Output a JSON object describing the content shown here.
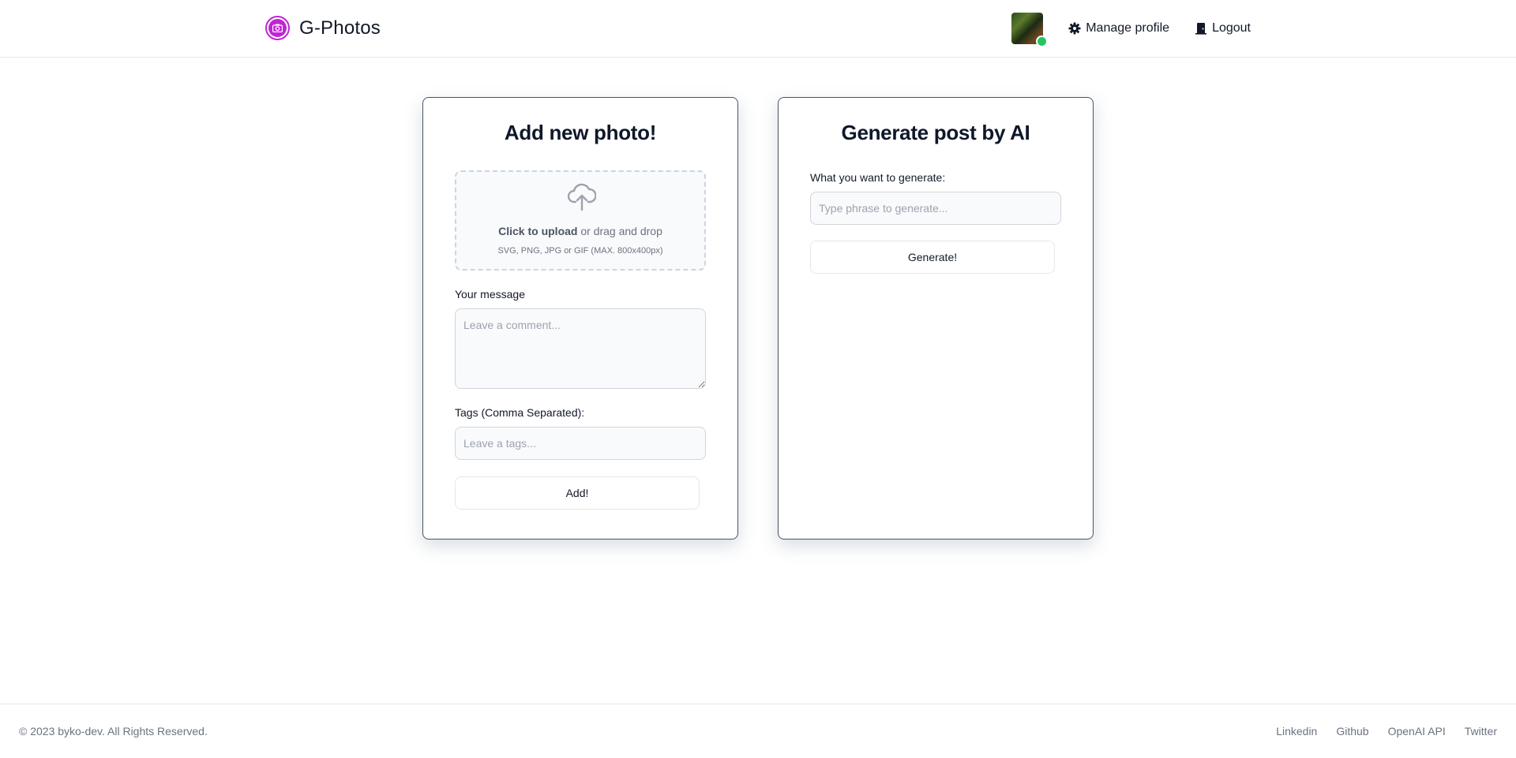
{
  "header": {
    "brand_name": "G-Photos",
    "brand_color": "#c026d3",
    "nav": {
      "manage_profile": "Manage profile",
      "logout": "Logout"
    },
    "avatar_status_color": "#22c55e"
  },
  "add_photo": {
    "title": "Add new photo!",
    "upload": {
      "click_text": "Click to upload",
      "rest_text": " or drag and drop",
      "hint": "SVG, PNG, JPG or GIF (MAX. 800x400px)"
    },
    "message_label": "Your message",
    "message_placeholder": "Leave a comment...",
    "tags_label": "Tags (Comma Separated):",
    "tags_placeholder": "Leave a tags...",
    "submit_label": "Add!"
  },
  "generate": {
    "title": "Generate post by AI",
    "phrase_label": "What you want to generate:",
    "phrase_placeholder": "Type phrase to generate...",
    "submit_label": "Generate!"
  },
  "footer": {
    "copyright": "© 2023 byko-dev. All Rights Reserved.",
    "links": [
      "Linkedin",
      "Github",
      "OpenAI API",
      "Twitter"
    ]
  }
}
